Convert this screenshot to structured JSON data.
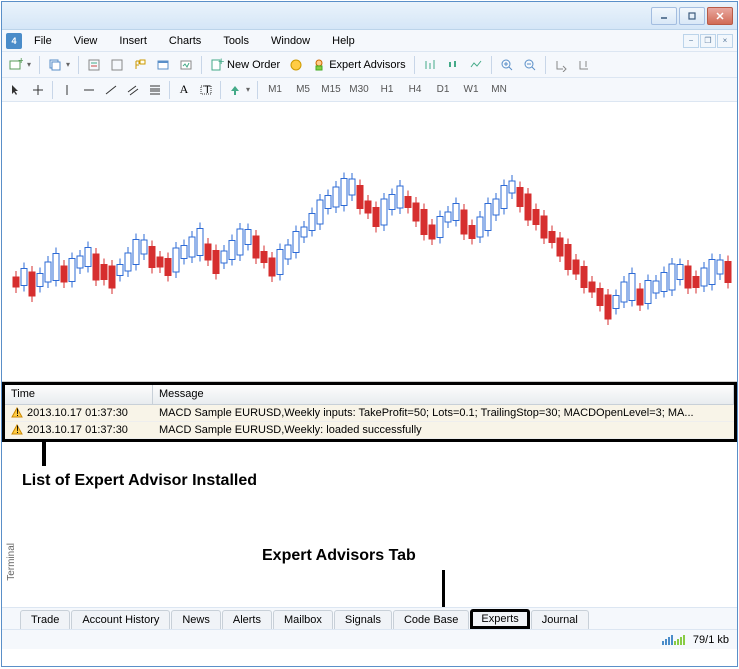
{
  "menubar": {
    "items": [
      "File",
      "View",
      "Insert",
      "Charts",
      "Tools",
      "Window",
      "Help"
    ]
  },
  "toolbar": {
    "new_order": "New Order",
    "expert_advisors": "Expert Advisors"
  },
  "timeframes": [
    "M1",
    "M5",
    "M15",
    "M30",
    "H1",
    "H4",
    "D1",
    "W1",
    "MN"
  ],
  "terminal": {
    "label": "Terminal",
    "headers": {
      "time": "Time",
      "message": "Message"
    },
    "rows": [
      {
        "time": "2013.10.17 01:37:30",
        "message": "MACD Sample EURUSD,Weekly inputs: TakeProfit=50; Lots=0.1; TrailingStop=30; MACDOpenLevel=3; MA..."
      },
      {
        "time": "2013.10.17 01:37:30",
        "message": "MACD Sample EURUSD,Weekly: loaded successfully"
      }
    ]
  },
  "annotations": {
    "list_label": "List of Expert Advisor Installed",
    "tab_label": "Expert Advisors Tab"
  },
  "tabs": [
    "Trade",
    "Account History",
    "News",
    "Alerts",
    "Mailbox",
    "Signals",
    "Code Base",
    "Experts",
    "Journal"
  ],
  "active_tab": "Experts",
  "statusbar": {
    "traffic": "79/1 kb"
  },
  "chart_data": {
    "type": "candlestick",
    "note": "Price chart with red/blue candlesticks, no axis labels visible",
    "candles_approx_count": 90
  }
}
